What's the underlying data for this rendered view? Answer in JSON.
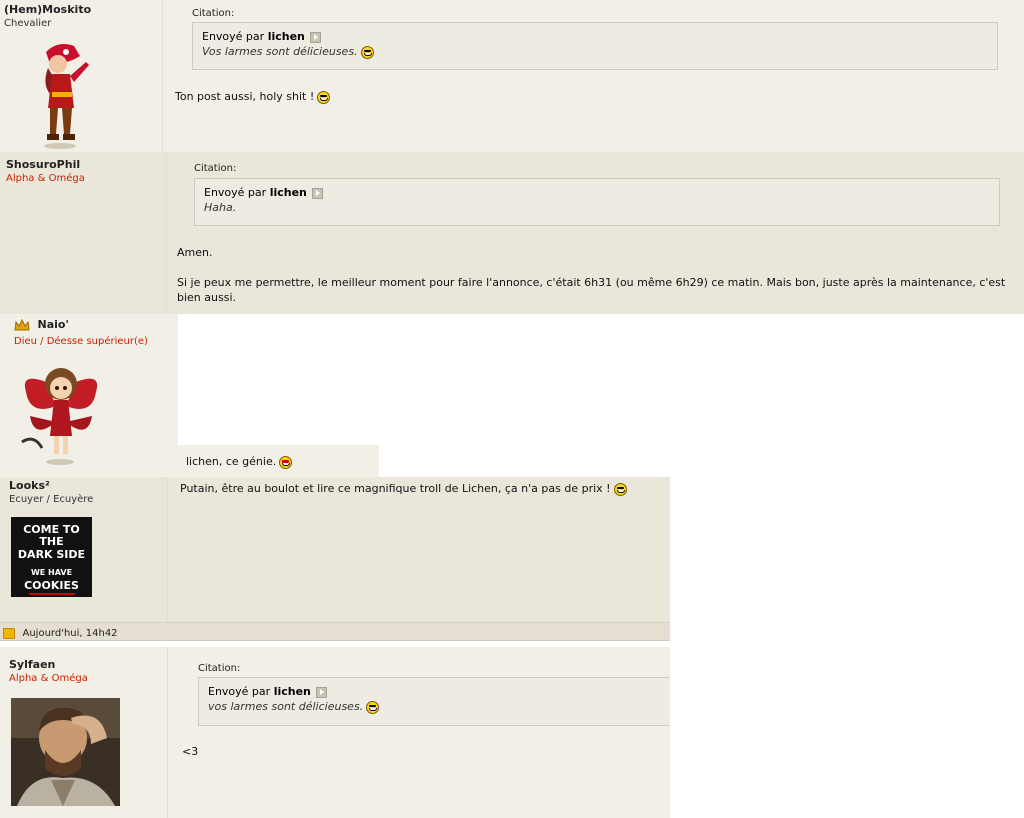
{
  "posts": [
    {
      "author": "(Hem)Moskito",
      "rank": "Chevalier",
      "quote_label": "Citation:",
      "quote_prefix": "Envoyé par",
      "quote_author": "lichen",
      "quote_text": "Vos larmes sont délicieuses.",
      "body": "Ton post aussi, holy shit !"
    },
    {
      "author": "ShosuroPhil",
      "rank": "Alpha & Oméga",
      "quote_label": "Citation:",
      "quote_prefix": "Envoyé par",
      "quote_author": "lichen",
      "quote_text": "Haha.",
      "body_line1": "Amen.",
      "body_line2": "Si je peux me permettre, le meilleur moment pour faire l'annonce, c'était 6h31 (ou même 6h29) ce matin. Mais bon, juste après la maintenance, c'est bien aussi."
    },
    {
      "author": "Naio'",
      "rank": "Dieu / Déesse supérieur(e)",
      "body": "lichen, ce génie."
    },
    {
      "author": "Looks²",
      "rank": "Ecuyer / Ecuyère",
      "avatar_lines": [
        "COME TO THE",
        "DARK SIDE",
        "WE HAVE",
        "COOKIES"
      ],
      "body": "Putain, être au boulot et lire ce magnifique troll de Lichen, ça n'a pas de prix !"
    },
    {
      "date": "Aujourd'hui, 14h42",
      "author": "Sylfaen",
      "rank": "Alpha & Oméga",
      "quote_label": "Citation:",
      "quote_prefix": "Envoyé par",
      "quote_author": "lichen",
      "quote_text": "vos larmes sont délicieuses.",
      "body": "<3"
    }
  ]
}
